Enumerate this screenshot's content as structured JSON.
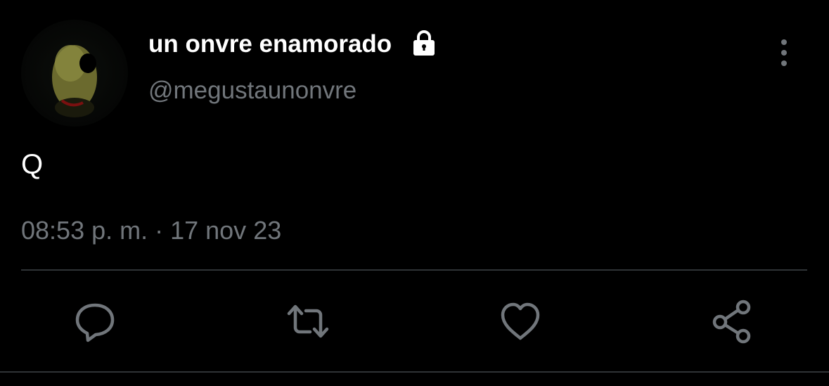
{
  "author": {
    "display_name": "un onvre enamorado",
    "handle": "@megustaunonvre",
    "protected": true
  },
  "tweet": {
    "text": "Q",
    "timestamp": "08:53 p. m. · 17 nov 23"
  },
  "icons": {
    "lock": "lock-icon",
    "more": "more-vertical-icon",
    "reply": "reply-bubble-icon",
    "retweet": "retweet-icon",
    "like": "heart-icon",
    "share": "share-icon"
  },
  "colors": {
    "background": "#000000",
    "primary_text": "#ffffff",
    "secondary_text": "#71767b",
    "divider": "#2f3336",
    "icon": "#71767b"
  }
}
